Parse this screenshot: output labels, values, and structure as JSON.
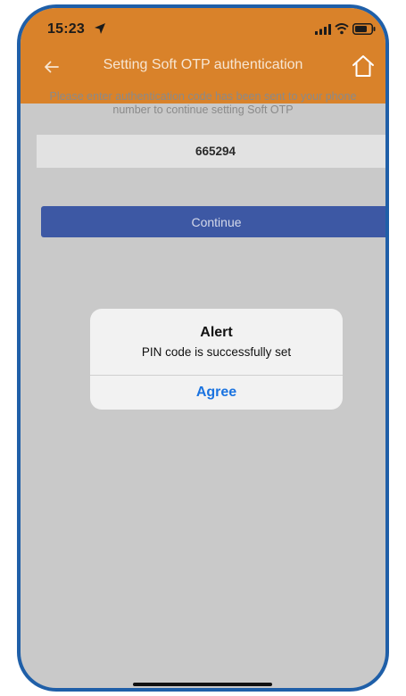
{
  "status_bar": {
    "time": "15:23",
    "location_icon": "location-arrow-icon",
    "signal_icon": "cellular-signal-icon",
    "wifi_icon": "wifi-icon",
    "battery_icon": "battery-icon"
  },
  "nav": {
    "title": "Setting Soft OTP authentication",
    "back_icon": "back-arrow-icon",
    "home_icon": "home-icon"
  },
  "form": {
    "instruction": "Please enter authentication code has been sent to your phone number to continue setting Soft OTP",
    "otp_value": "665294",
    "continue_label": "Continue"
  },
  "alert": {
    "title": "Alert",
    "message": "PIN code is successfully set",
    "button_label": "Agree"
  },
  "colors": {
    "header": "#d9822a",
    "overlay_background": "#c9c9c9",
    "primary_button": "#3d58a4",
    "alert_button_text": "#1a73e0",
    "device_border": "#1f5fa8"
  }
}
